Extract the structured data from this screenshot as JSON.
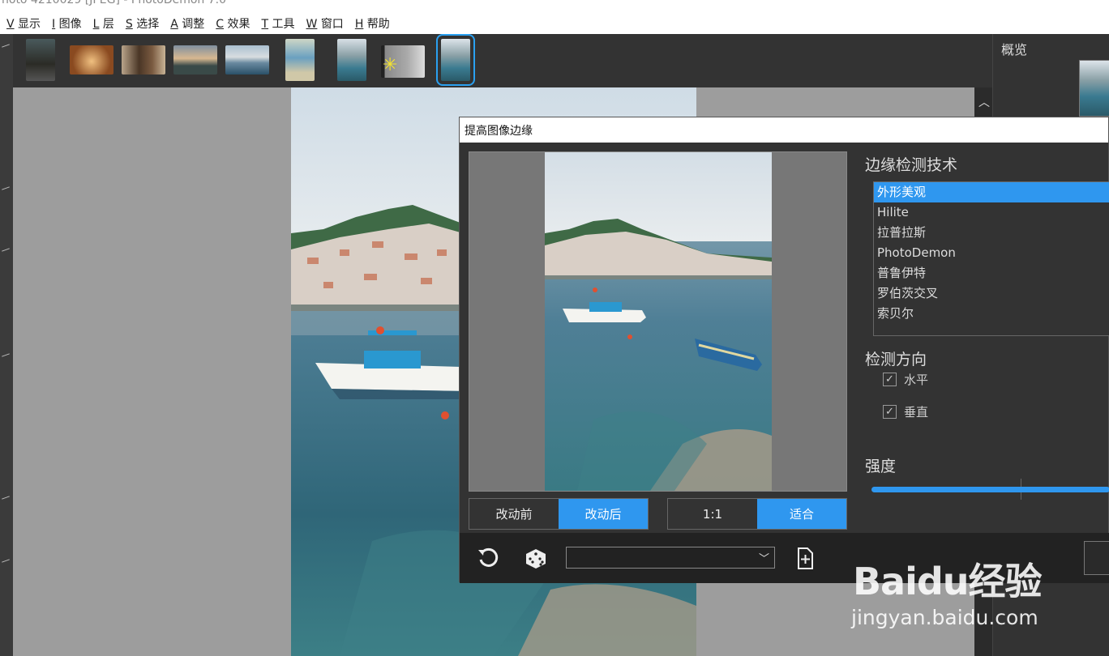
{
  "app": {
    "title_fragment": "noto 4210029 [JPEG] - PhotoDemon 7.0"
  },
  "menu": [
    {
      "key": "V",
      "label": "显示"
    },
    {
      "key": "I",
      "label": "图像"
    },
    {
      "key": "L",
      "label": "层"
    },
    {
      "key": "S",
      "label": "选择"
    },
    {
      "key": "A",
      "label": "调整"
    },
    {
      "key": "C",
      "label": "效果"
    },
    {
      "key": "T",
      "label": "工具"
    },
    {
      "key": "W",
      "label": "窗口"
    },
    {
      "key": "H",
      "label": "帮助"
    }
  ],
  "right_panel": {
    "title": "概览"
  },
  "dialog": {
    "title": "提高图像边缘",
    "view_buttons": {
      "before": "改动前",
      "after": "改动后",
      "one_to_one": "1:1",
      "fit": "适合"
    },
    "technique": {
      "label": "边缘检测技术",
      "items": [
        "外形美观",
        "Hilite",
        "拉普拉斯",
        "PhotoDemon",
        "普鲁伊特",
        "罗伯茨交叉",
        "索贝尔"
      ],
      "selected": "外形美观"
    },
    "direction": {
      "label": "检测方向",
      "horizontal": {
        "label": "水平",
        "checked": true
      },
      "vertical": {
        "label": "垂直",
        "checked": true
      }
    },
    "strength": {
      "label": "强度"
    },
    "preset": {
      "value": ""
    }
  },
  "watermark": {
    "brand": "Baidu经验",
    "url": "jingyan.baidu.com"
  },
  "colors": {
    "accent": "#2f97ef",
    "background": "#333333",
    "canvas": "#9d9d9d"
  }
}
